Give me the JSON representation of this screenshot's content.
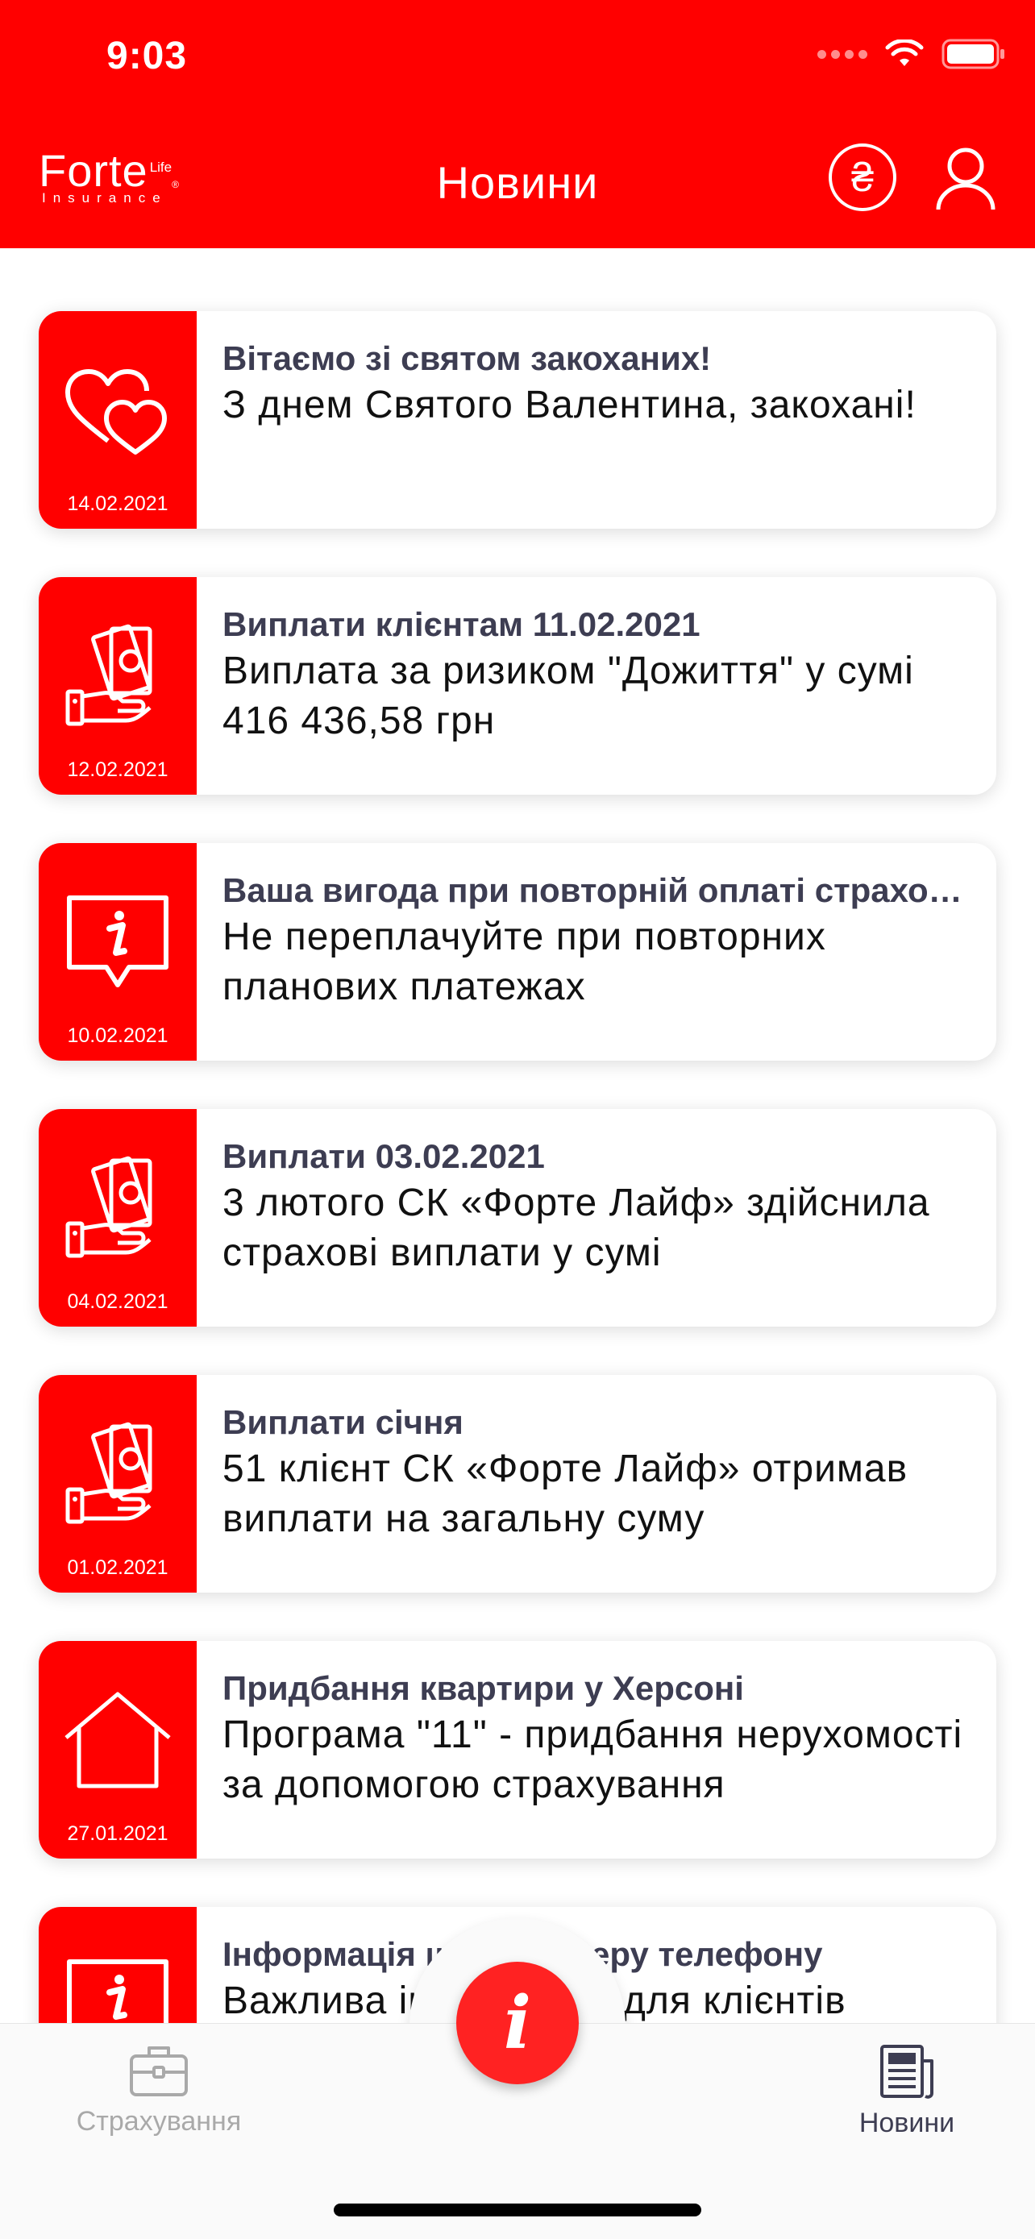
{
  "status_bar": {
    "time": "9:03"
  },
  "header": {
    "logo_main": "Forte",
    "logo_life": "Life",
    "logo_sub": "Insurance",
    "title": "Новини",
    "currency_symbol": "₴"
  },
  "news": [
    {
      "icon": "hearts-icon",
      "date": "14.02.2021",
      "title": "Вітаємо зі святом закоханих!",
      "text": "З днем Святого Валентина, закохані!"
    },
    {
      "icon": "money-hand-icon",
      "date": "12.02.2021",
      "title": "Виплати клієнтам 11.02.2021",
      "text": "Виплата за ризиком \"Дожиття\" у сумі 416 436,58 грн"
    },
    {
      "icon": "info-bubble-icon",
      "date": "10.02.2021",
      "title": "Ваша вигода при повторній оплаті страхових внесків",
      "text": "Не переплачуйте при повторних планових платежах"
    },
    {
      "icon": "money-hand-icon",
      "date": "04.02.2021",
      "title": "Виплати 03.02.2021",
      "text": "3 лютого СК «Форте Лайф» здійснила страхові виплати у сумі"
    },
    {
      "icon": "money-hand-icon",
      "date": "01.02.2021",
      "title": "Виплати січня",
      "text": "51 клієнт СК «Форте Лайф» отримав виплати на загальну суму"
    },
    {
      "icon": "house-icon",
      "date": "27.01.2021",
      "title": "Придбання квартири у Херсоні",
      "text": "Програма \"11\" - придбання нерухомості за допомогою страхування"
    },
    {
      "icon": "info-bubble-icon",
      "date": "",
      "title": "Інформація щодо номеру телефону",
      "text": "Важлива інформація для клієнтів"
    }
  ],
  "tabbar": {
    "insurance_label": "Страхування",
    "news_label": "Новини",
    "center_symbol": "i"
  },
  "colors": {
    "brand_red": "#ff0000",
    "title_text": "#3d3d52",
    "inactive_tab": "#a9a9a9"
  }
}
